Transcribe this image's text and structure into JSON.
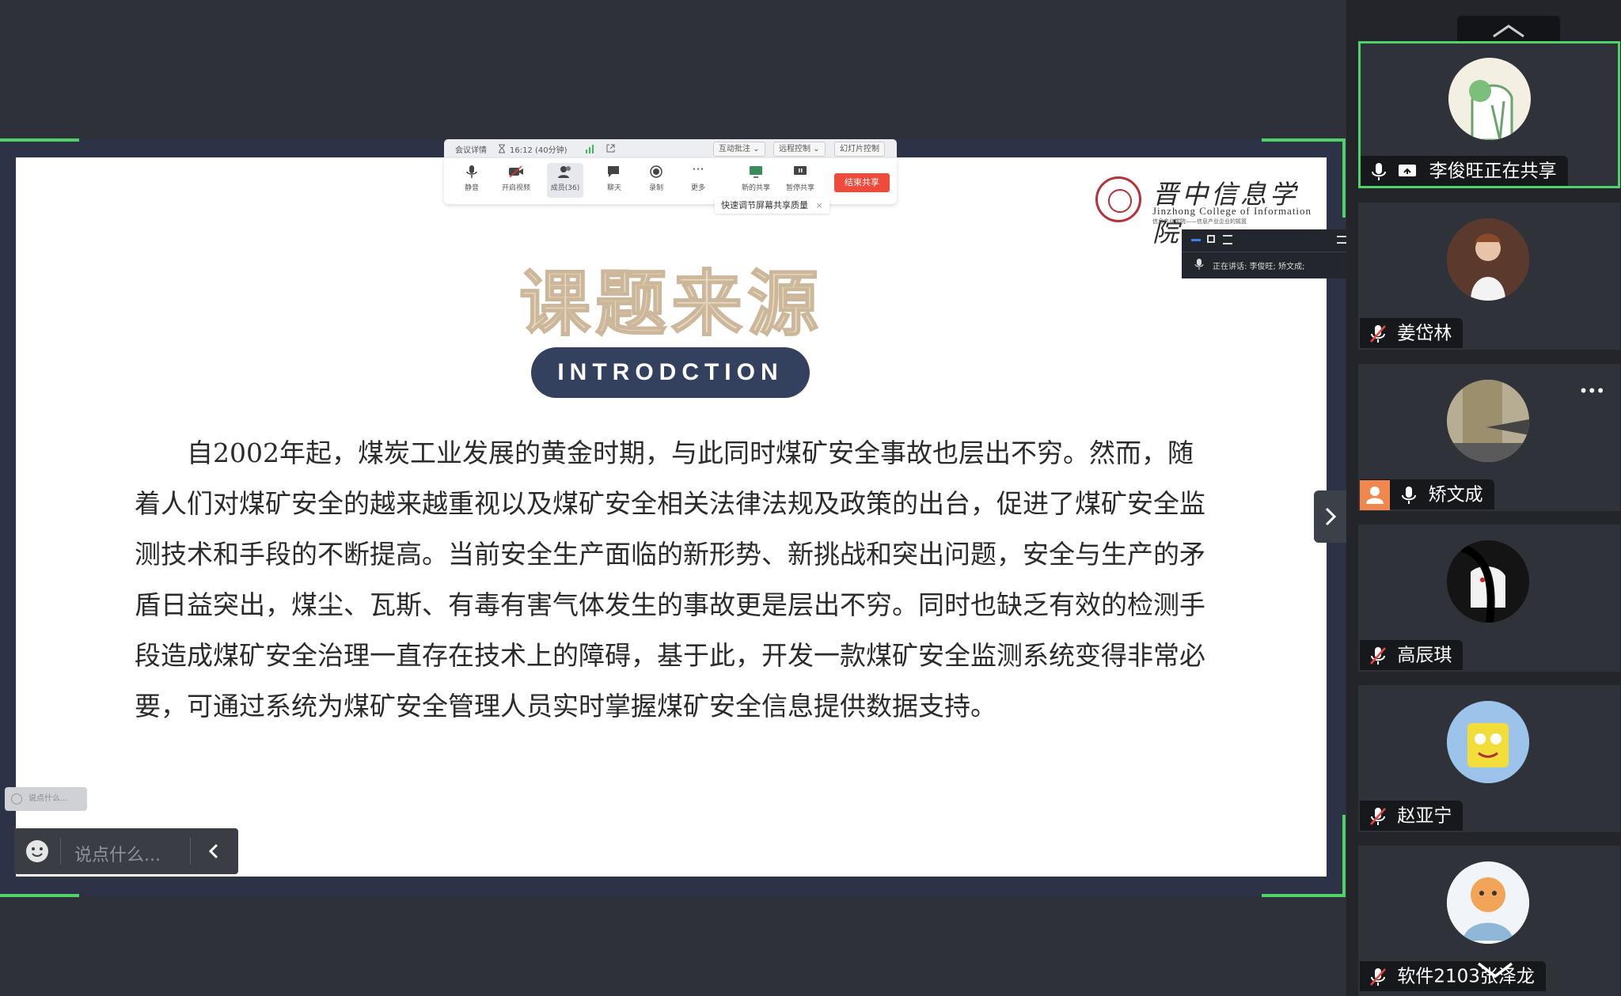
{
  "toolbar": {
    "meeting_details": "会议详情",
    "timer": "16:12 (40分钟)",
    "interactive_annotation": "互动批注",
    "remote_control": "远程控制",
    "slide_control": "幻灯片控制",
    "items": {
      "mute": "静音",
      "video": "开启视频",
      "members": "成员(36)",
      "chat": "聊天",
      "record": "录制",
      "more": "更多",
      "new_share": "新的共享",
      "pause_share": "暂停共享"
    },
    "end_share": "结束共享",
    "tip": "快速调节屏幕共享质量"
  },
  "speaking": {
    "text": "正在讲话: 李俊旺; 矫文成;"
  },
  "slide": {
    "college_cn": "晋中信息学院",
    "college_en": "Jinzhong College of Information",
    "college_sub": "信息产业学院——信息产业企业的摇篮",
    "title": "课题来源",
    "subtitle": "INTRODCTION",
    "paragraph": "自2002年起，煤炭工业发展的黄金时期，与此同时煤矿安全事故也层出不穷。然而，随着人们对煤矿安全的越来越重视以及煤矿安全相关法律法规及政策的出台，促进了煤矿安全监测技术和手段的不断提高。当前安全生产面临的新形势、新挑战和突出问题，安全与生产的矛盾日益突出，煤尘、瓦斯、有毒有害气体发生的事故更是层出不穷。同时也缺乏有效的检测手段造成煤矿安全治理一直存在技术上的障碍，基于此，开发一款煤矿安全监测系统变得非常必要，可通过系统为煤矿安全管理人员实时掌握煤矿安全信息提供数据支持。"
  },
  "chat": {
    "mini_placeholder": "说点什么...",
    "placeholder": "说点什么..."
  },
  "participants": [
    {
      "name": "李俊旺正在共享",
      "mic": "on",
      "sharing": true
    },
    {
      "name": "姜岱林",
      "mic": "muted"
    },
    {
      "name": "矫文成",
      "mic": "on",
      "host": true
    },
    {
      "name": "高辰琪",
      "mic": "muted"
    },
    {
      "name": "赵亚宁",
      "mic": "muted"
    },
    {
      "name": "软件2103张泽龙",
      "mic": "muted"
    }
  ],
  "colors": {
    "share_border": "#4fd269",
    "end_button": "#ef4a3b",
    "pill": "#33415e"
  }
}
